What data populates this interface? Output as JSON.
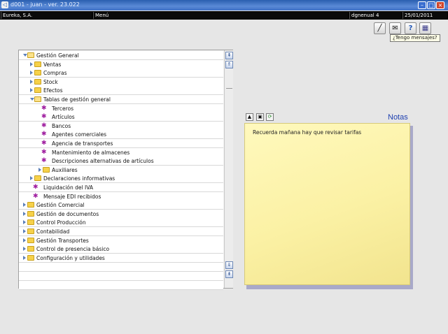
{
  "window": {
    "title": "d001 - juan - ver. 23.022",
    "app_icon": "◁",
    "min": "–",
    "max": "□",
    "close": "×"
  },
  "status": {
    "company": "Eureka, S.A.",
    "menu": "Menú",
    "user": "dgnenual 4",
    "date": "25/01/2011"
  },
  "toolbar": {
    "items": [
      {
        "icon": "wand-icon",
        "glyph": "╱"
      },
      {
        "icon": "messages-icon",
        "glyph": "✉"
      },
      {
        "icon": "help-icon",
        "glyph": "?"
      },
      {
        "icon": "calendar-icon",
        "glyph": "▦"
      }
    ],
    "tooltip": "¿Tengo mensajes?"
  },
  "tree": {
    "items": [
      {
        "label": "Gestión General",
        "level": 0,
        "state": "open",
        "type": "folder"
      },
      {
        "label": "Ventas",
        "level": 1,
        "state": "closed",
        "type": "folder"
      },
      {
        "label": "Compras",
        "level": 1,
        "state": "closed",
        "type": "folder"
      },
      {
        "label": "Stock",
        "level": 1,
        "state": "closed",
        "type": "folder"
      },
      {
        "label": "Efectos",
        "level": 1,
        "state": "closed",
        "type": "folder"
      },
      {
        "label": "Tablas de gestión general",
        "level": 1,
        "state": "open",
        "type": "folder"
      },
      {
        "label": "Terceros",
        "level": 2,
        "type": "leaf"
      },
      {
        "label": "Artículos",
        "level": 2,
        "type": "leaf"
      },
      {
        "label": "Bancos",
        "level": 2,
        "type": "leaf"
      },
      {
        "label": "Agentes comerciales",
        "level": 2,
        "type": "leaf"
      },
      {
        "label": "Agencia de transportes",
        "level": 2,
        "type": "leaf"
      },
      {
        "label": "Mantenimiento de almacenes",
        "level": 2,
        "type": "leaf"
      },
      {
        "label": "Descripciones alternativas de artículos",
        "level": 2,
        "type": "leaf"
      },
      {
        "label": "Auxiliares",
        "level": 2,
        "state": "closed",
        "type": "folder"
      },
      {
        "label": "Declaraciones informativas",
        "level": 1,
        "state": "closed",
        "type": "folder"
      },
      {
        "label": "Liquidación del IVA",
        "level": 1,
        "type": "leaf"
      },
      {
        "label": "Mensaje EDI recibidos",
        "level": 1,
        "type": "leaf"
      },
      {
        "label": "Gestión Comercial",
        "level": 0,
        "state": "closed",
        "type": "folder"
      },
      {
        "label": "Gestión de documentos",
        "level": 0,
        "state": "closed",
        "type": "folder"
      },
      {
        "label": "Control Producción",
        "level": 0,
        "state": "closed",
        "type": "folder"
      },
      {
        "label": "Contabilidad",
        "level": 0,
        "state": "closed",
        "type": "folder"
      },
      {
        "label": "Gestión Transportes",
        "level": 0,
        "state": "closed",
        "type": "folder"
      },
      {
        "label": "Control de presencia básico",
        "level": 0,
        "state": "closed",
        "type": "folder"
      },
      {
        "label": "Configuración y utilidades",
        "level": 0,
        "state": "closed",
        "type": "folder"
      }
    ],
    "empty_rows": 3,
    "scroll": {
      "top": "⇞",
      "up": "⇑",
      "down": "⇓",
      "bottom": "⇟"
    }
  },
  "notes": {
    "title": "Notas",
    "tools": [
      "▲",
      "▣",
      "⟳"
    ],
    "text": "Recuerda mañana hay que revisar tarifas"
  },
  "colors": {
    "accent": "#1d3fb0",
    "folder": "#f6d14a",
    "leaf": "#a020a0",
    "note": "#fbf1a4"
  }
}
